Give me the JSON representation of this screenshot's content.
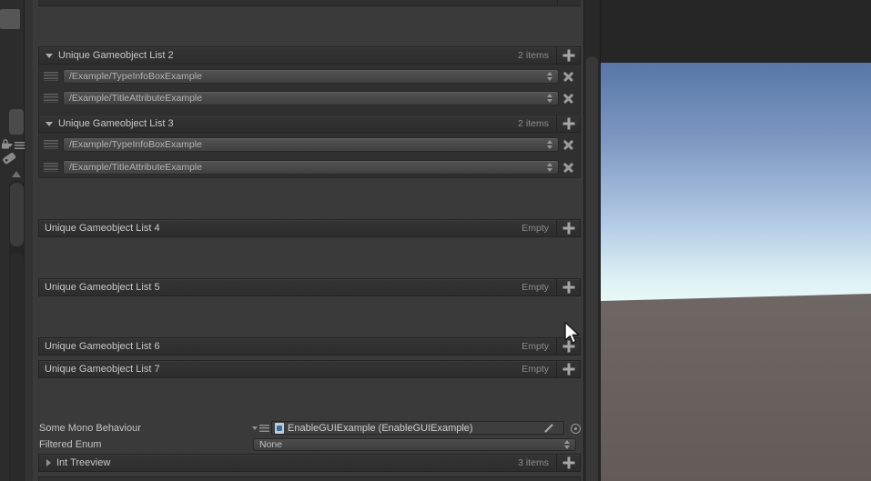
{
  "inspector": {
    "lists": [
      {
        "name": "Unique Gameobject List 2",
        "count": "2 items",
        "items": [
          "/Example/TypeInfoBoxExample",
          "/Example/TitleAttributeExample"
        ]
      },
      {
        "name": "Unique Gameobject List 3",
        "count": "2 items",
        "items": [
          "/Example/TypeInfoBoxExample",
          "/Example/TitleAttributeExample"
        ]
      },
      {
        "name": "Unique Gameobject List 4",
        "count": "Empty"
      },
      {
        "name": "Unique Gameobject List 5",
        "count": "Empty"
      },
      {
        "name": "Unique Gameobject List 6",
        "count": "Empty"
      },
      {
        "name": "Unique Gameobject List 7",
        "count": "Empty"
      }
    ],
    "mono_behaviour": {
      "label": "Some Mono Behaviour",
      "value": "EnableGUIExample (EnableGUIExample)"
    },
    "filtered_enum": {
      "label": "Filtered Enum",
      "value": "None"
    },
    "int_treeview": {
      "label": "Int Treeview",
      "count": "3 items"
    }
  },
  "icons": {
    "foldout-open": "▼",
    "foldout-closed": "▶",
    "add": "+",
    "remove": "✕",
    "drag-handle": "≡",
    "stepper": "⇕",
    "object-picker": "⊙",
    "pencil": "✎",
    "lock": "🔒",
    "tag": "🏷",
    "preset": "▾≡",
    "scroll-up": "▲",
    "script": "📄"
  },
  "colors": {
    "panel_bg": "#3a3a3a",
    "header_bg": "#2f2f2f",
    "field_bg": "#474747",
    "scene_top": "#262626",
    "sky_top": "#5877a7",
    "sky_horizon": "#ecfbf8",
    "ground": "#6b6360"
  }
}
